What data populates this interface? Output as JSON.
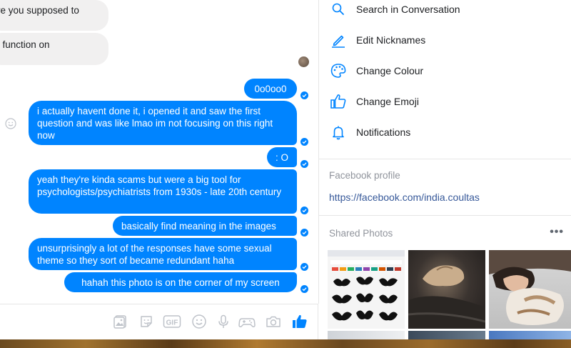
{
  "chat": {
    "messages": [
      {
        "dir": "in",
        "text": "re you supposed to"
      },
      {
        "dir": "in",
        "text": "t function on"
      },
      {
        "dir": "out",
        "text": "0o0oo0"
      },
      {
        "dir": "out",
        "text": "i actually havent done it, i opened it and saw the first question and was like lmao im not focusing on this right now"
      },
      {
        "dir": "out",
        "text": ": O"
      },
      {
        "dir": "out",
        "text": "yeah they're kinda scams but were a big tool for psychologists/psychiatrists from 1930s - late 20th century"
      },
      {
        "dir": "out",
        "text": "basically find meaning in the images"
      },
      {
        "dir": "out",
        "text": "unsurprisingly a lot of the responses have some sexual theme so they sort of became redundant haha"
      },
      {
        "dir": "out",
        "text": "hahah this photo is on the corner of my screen"
      }
    ]
  },
  "composer": {
    "tools": [
      {
        "icon": "photos-icon"
      },
      {
        "icon": "sticker-icon"
      },
      {
        "icon": "gif-icon",
        "label": "GIF"
      },
      {
        "icon": "emoji-icon"
      },
      {
        "icon": "microphone-icon"
      },
      {
        "icon": "game-controller-icon"
      },
      {
        "icon": "camera-icon"
      },
      {
        "icon": "thumbs-up-icon"
      }
    ]
  },
  "panel": {
    "options": [
      {
        "label": "Search in Conversation",
        "icon": "search-icon"
      },
      {
        "label": "Edit Nicknames",
        "icon": "pencil-icon"
      },
      {
        "label": "Change Colour",
        "icon": "palette-icon"
      },
      {
        "label": "Change Emoji",
        "icon": "thumbs-up-icon"
      },
      {
        "label": "Notifications",
        "icon": "bell-icon"
      }
    ],
    "profile_title": "Facebook profile",
    "profile_link": "https://facebook.com/india.coultas",
    "shared_title": "Shared Photos",
    "more_label": "•••"
  },
  "colors": {
    "accent": "#0084ff",
    "incoming": "#f1f0f0",
    "link": "#365899"
  }
}
